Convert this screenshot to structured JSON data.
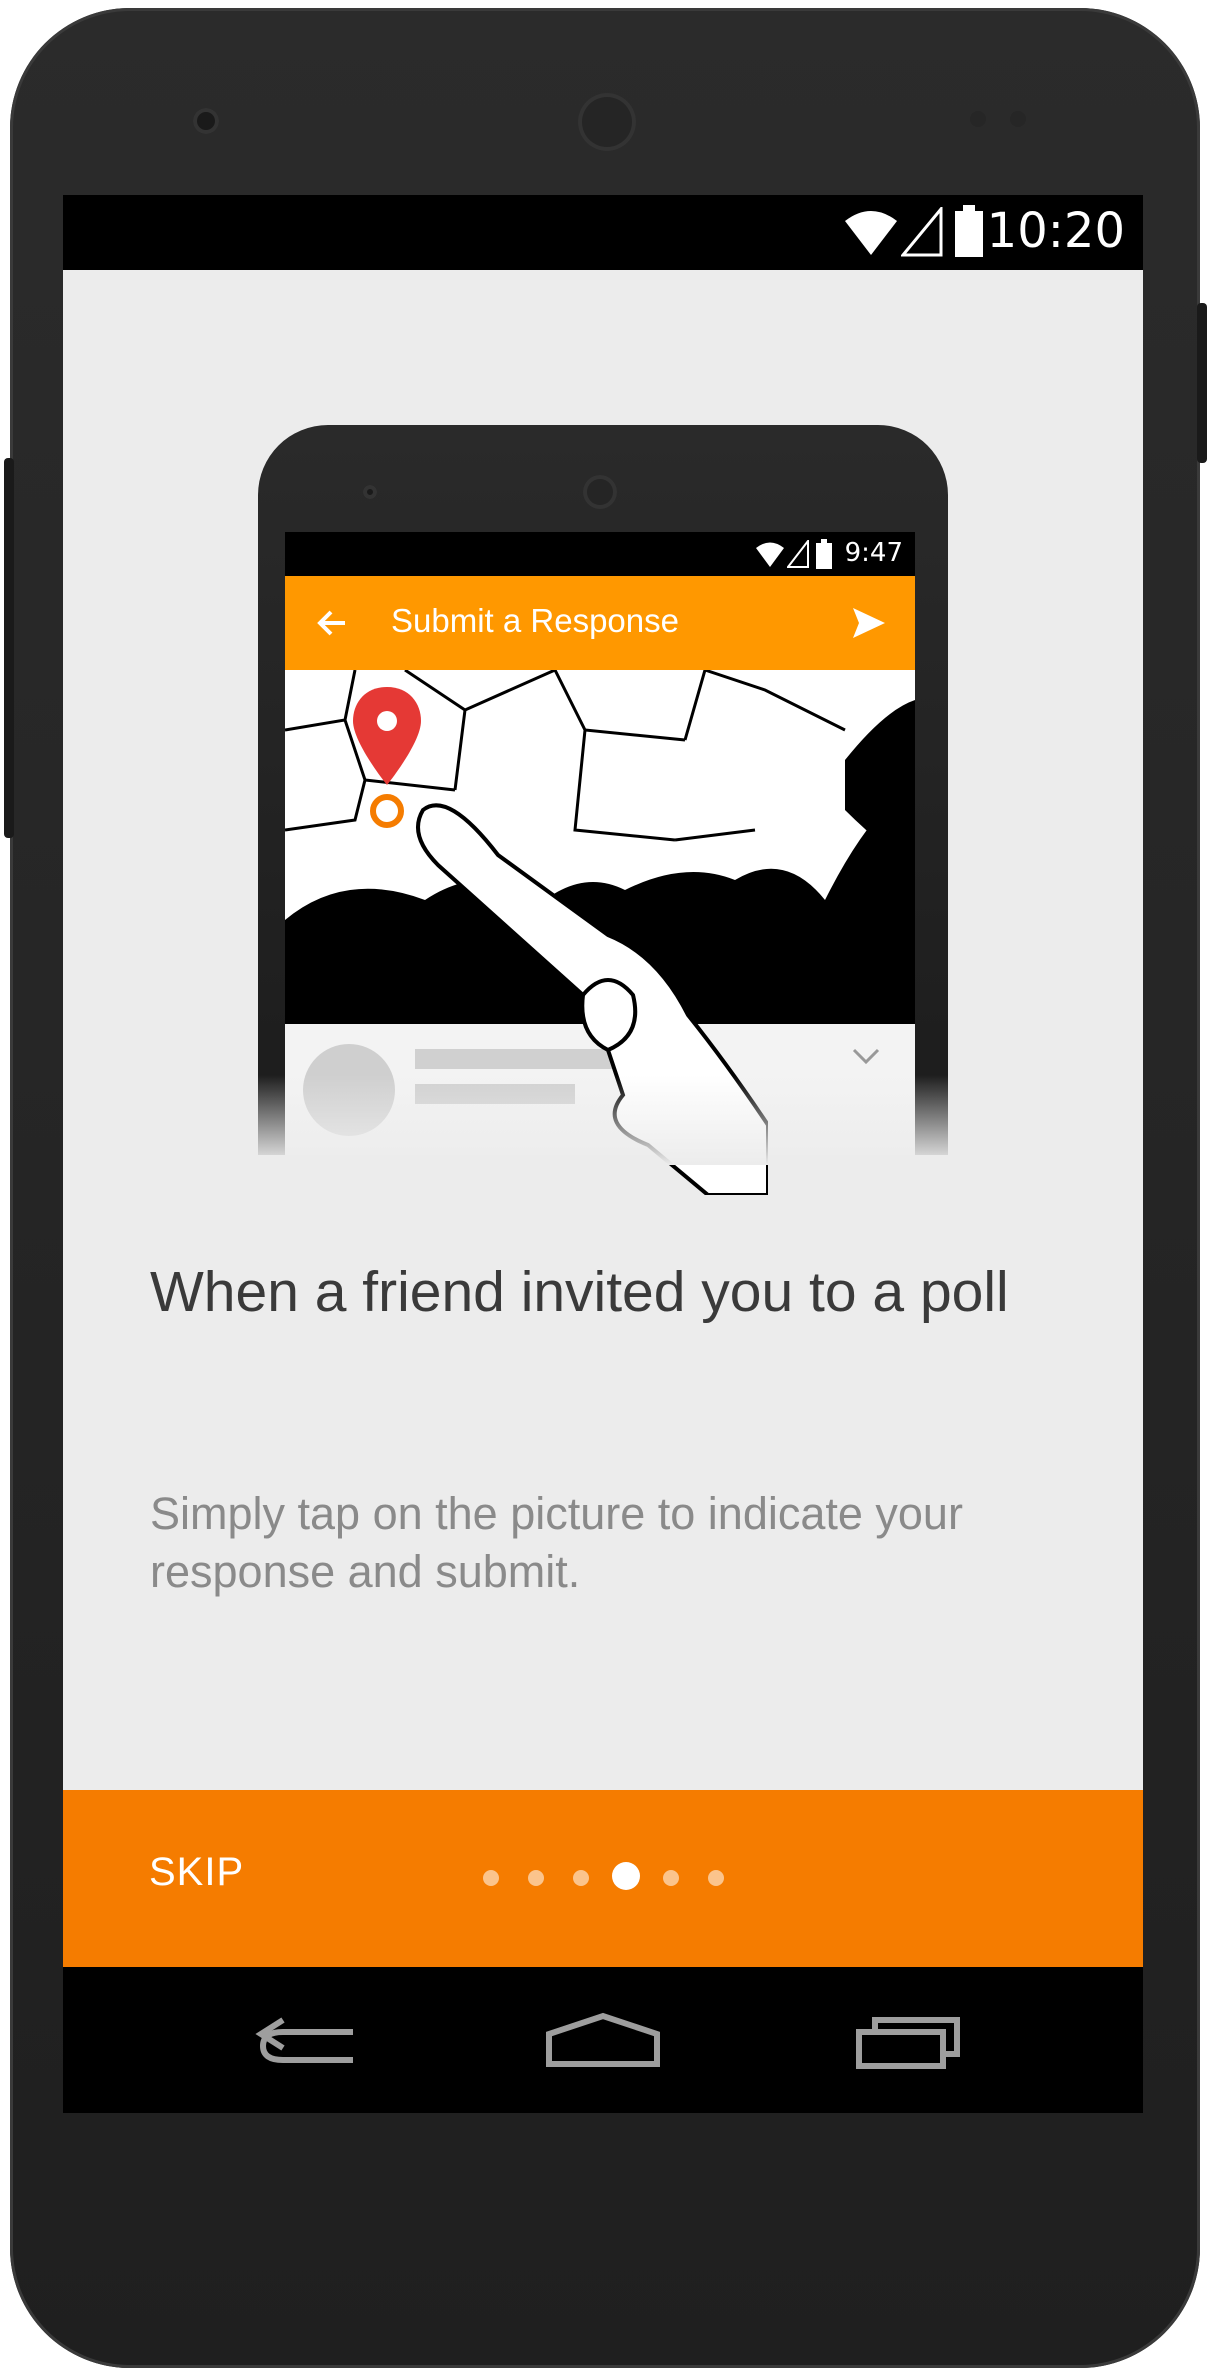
{
  "status_bar": {
    "time": "10:20"
  },
  "illustration": {
    "status_time": "9:47",
    "toolbar_title": "Submit a Response",
    "back_icon": "arrow-left-icon",
    "send_icon": "send-icon"
  },
  "content": {
    "title": "When a friend invited you to a poll",
    "description": "Simply tap on the picture to indicate your response and submit."
  },
  "bottom_bar": {
    "skip_label": "SKIP",
    "page_count": 6,
    "current_page_index": 3,
    "color": "#f57c00"
  },
  "nav_bar": {
    "back_icon": "back-icon",
    "home_icon": "home-icon",
    "recents_icon": "recents-icon"
  },
  "colors": {
    "accent_orange": "#f57c00",
    "toolbar_orange": "#ff9800",
    "background": "#ececec",
    "pin_red": "#e53935"
  }
}
